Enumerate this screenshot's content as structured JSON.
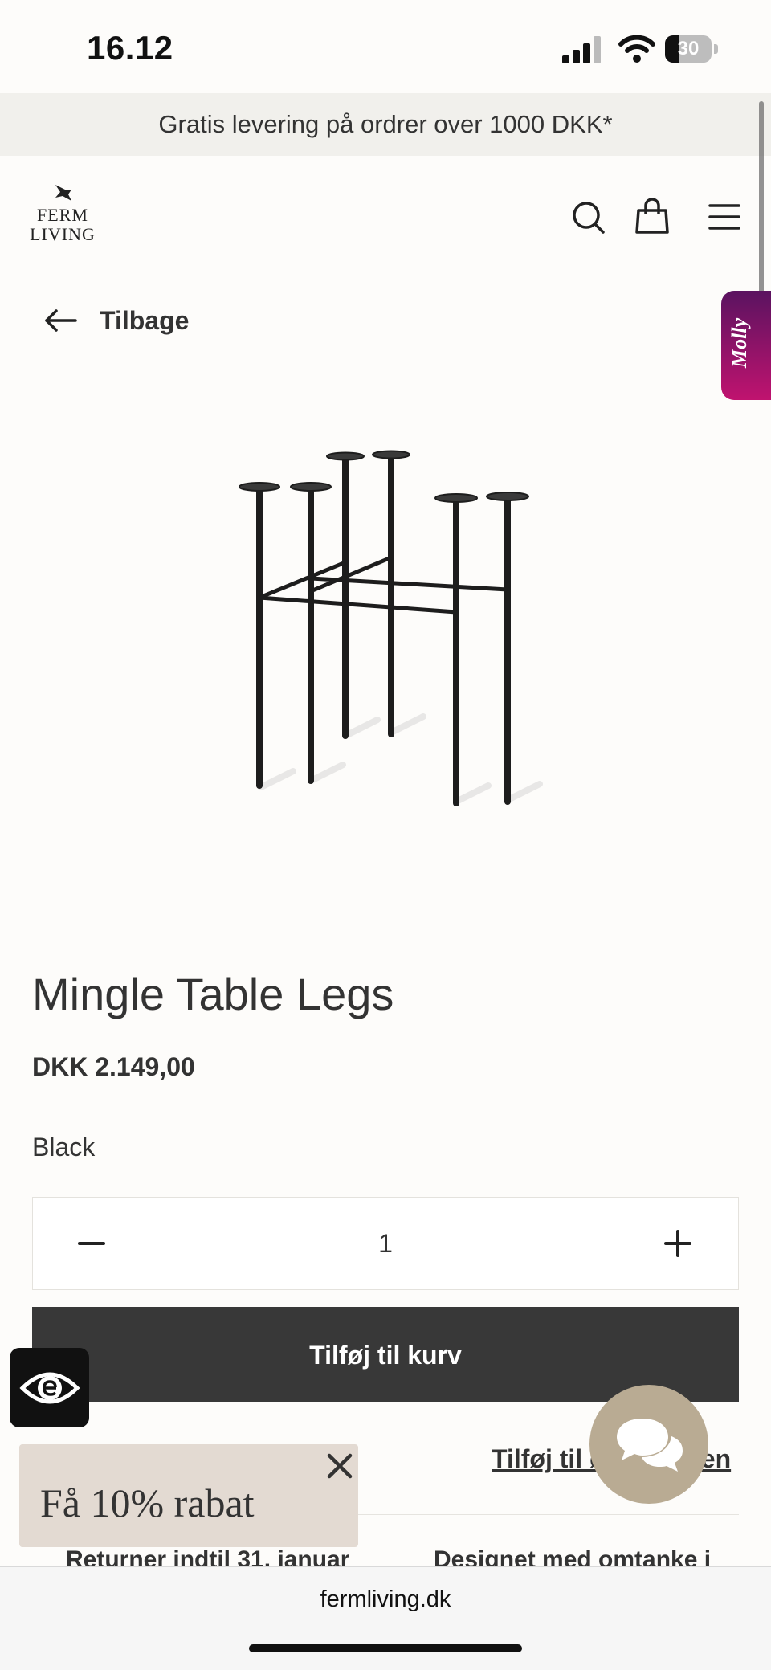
{
  "status_bar": {
    "time": "16.12",
    "battery": "30",
    "battery_level": 0.3
  },
  "promo": {
    "text": "Gratis levering på ordrer over 1000 DKK*"
  },
  "header": {
    "logo_line1": "FERM",
    "logo_line2": "LIVING",
    "icons": [
      "search-icon",
      "shopping-bag-icon",
      "menu-icon"
    ]
  },
  "back": {
    "label": "Tilbage"
  },
  "molly": {
    "label": "Molly"
  },
  "product": {
    "title": "Mingle Table Legs",
    "price": "DKK 2.149,00",
    "variant": "Black",
    "quantity": "1",
    "add_to_cart": "Tilføj til kurv",
    "wishlist": "Tilføj til ønskelisten"
  },
  "features": {
    "left": "Returner indtil 31. januar",
    "right": "Designet med omtanke i"
  },
  "discount": {
    "text": "Få 10% rabat"
  },
  "browser": {
    "url": "fermliving.dk"
  },
  "colors": {
    "button": "#383838",
    "chat": "#b9ab93",
    "molly_top": "#5a1360",
    "molly_bottom": "#c0136f",
    "popup": "#e3dad2"
  }
}
